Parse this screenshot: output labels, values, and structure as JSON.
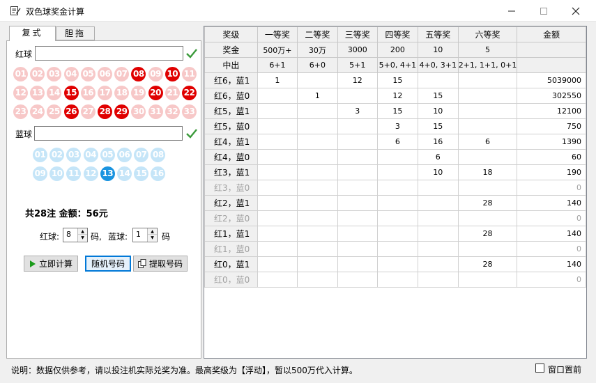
{
  "window": {
    "title": "双色球奖金计算"
  },
  "tabs": [
    {
      "label": "复式"
    },
    {
      "label": "胆拖"
    }
  ],
  "red": {
    "label": "红球",
    "value": "",
    "balls": [
      "01",
      "02",
      "03",
      "04",
      "05",
      "06",
      "07",
      "08",
      "09",
      "10",
      "11",
      "12",
      "13",
      "14",
      "15",
      "16",
      "17",
      "18",
      "19",
      "20",
      "21",
      "22",
      "23",
      "24",
      "25",
      "26",
      "27",
      "28",
      "29",
      "30",
      "31",
      "32",
      "33"
    ],
    "selected": [
      "08",
      "10",
      "15",
      "20",
      "22",
      "26",
      "28",
      "29"
    ]
  },
  "blue": {
    "label": "蓝球",
    "value": "",
    "balls": [
      "01",
      "02",
      "03",
      "04",
      "05",
      "06",
      "07",
      "08",
      "09",
      "10",
      "11",
      "12",
      "13",
      "14",
      "15",
      "16"
    ],
    "selected": [
      "13"
    ]
  },
  "summary": {
    "text": "共28注  金额：56元"
  },
  "counts": {
    "red_label": "红球:",
    "red_value": "8",
    "code1": "码,",
    "blue_label": "蓝球:",
    "blue_value": "1",
    "code2": "码"
  },
  "buttons": {
    "calc": "立即计算",
    "random": "随机号码",
    "extract": "提取号码"
  },
  "table": {
    "headers": [
      "奖级",
      "一等奖",
      "二等奖",
      "三等奖",
      "四等奖",
      "五等奖",
      "六等奖",
      "金额"
    ],
    "prize_row": [
      "奖金",
      "500万+",
      "30万",
      "3000",
      "200",
      "10",
      "5",
      ""
    ],
    "rule_row": [
      "中出",
      "6+1",
      "6+0",
      "5+1",
      "5+0, 4+1",
      "4+0, 3+1",
      "2+1, 1+1, 0+1",
      ""
    ],
    "rows": [
      {
        "label": "红6，蓝1",
        "cells": [
          "1",
          "",
          "12",
          "15",
          "",
          ""
        ],
        "amount": "5039000",
        "dim": false
      },
      {
        "label": "红6，蓝0",
        "cells": [
          "",
          "1",
          "",
          "12",
          "15",
          ""
        ],
        "amount": "302550",
        "dim": false
      },
      {
        "label": "红5，蓝1",
        "cells": [
          "",
          "",
          "3",
          "15",
          "10",
          ""
        ],
        "amount": "12100",
        "dim": false
      },
      {
        "label": "红5，蓝0",
        "cells": [
          "",
          "",
          "",
          "3",
          "15",
          ""
        ],
        "amount": "750",
        "dim": false
      },
      {
        "label": "红4，蓝1",
        "cells": [
          "",
          "",
          "",
          "6",
          "16",
          "6"
        ],
        "amount": "1390",
        "dim": false
      },
      {
        "label": "红4，蓝0",
        "cells": [
          "",
          "",
          "",
          "",
          "6",
          ""
        ],
        "amount": "60",
        "dim": false
      },
      {
        "label": "红3，蓝1",
        "cells": [
          "",
          "",
          "",
          "",
          "10",
          "18"
        ],
        "amount": "190",
        "dim": false
      },
      {
        "label": "红3，蓝0",
        "cells": [
          "",
          "",
          "",
          "",
          "",
          ""
        ],
        "amount": "0",
        "dim": true
      },
      {
        "label": "红2，蓝1",
        "cells": [
          "",
          "",
          "",
          "",
          "",
          "28"
        ],
        "amount": "140",
        "dim": false
      },
      {
        "label": "红2，蓝0",
        "cells": [
          "",
          "",
          "",
          "",
          "",
          ""
        ],
        "amount": "0",
        "dim": true
      },
      {
        "label": "红1，蓝1",
        "cells": [
          "",
          "",
          "",
          "",
          "",
          "28"
        ],
        "amount": "140",
        "dim": false
      },
      {
        "label": "红1，蓝0",
        "cells": [
          "",
          "",
          "",
          "",
          "",
          ""
        ],
        "amount": "0",
        "dim": true
      },
      {
        "label": "红0，蓝1",
        "cells": [
          "",
          "",
          "",
          "",
          "",
          "28"
        ],
        "amount": "140",
        "dim": false
      },
      {
        "label": "红0，蓝0",
        "cells": [
          "",
          "",
          "",
          "",
          "",
          ""
        ],
        "amount": "0",
        "dim": true
      }
    ]
  },
  "status": {
    "note": "说明：数据仅供参考，请以投注机实际兑奖为准。最高奖级为【浮动】，暂以500万代入计算。",
    "topmost_label": "窗口置前",
    "topmost_checked": false
  },
  "colors": {
    "red_selected": "#e00000",
    "red_unselected": "#f7c8c8",
    "blue_selected": "#1a94e0",
    "blue_unselected": "#c5e5f8",
    "check": "#3a9a3a"
  }
}
